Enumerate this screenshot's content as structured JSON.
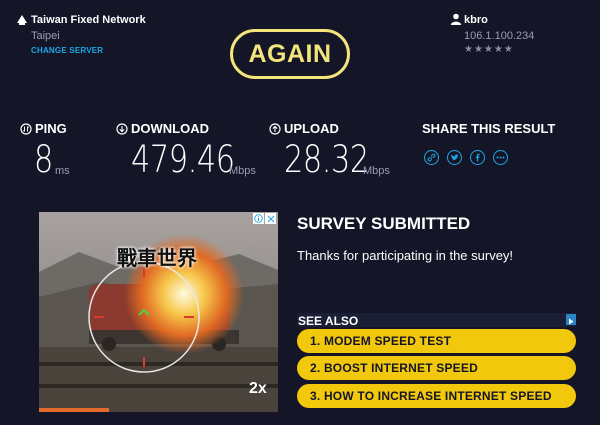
{
  "server": {
    "name": "Taiwan Fixed Network",
    "city": "Taipei",
    "change_label": "CHANGE SERVER"
  },
  "again_label": "AGAIN",
  "user": {
    "name": "kbro",
    "ip": "106.1.100.234",
    "stars": "★★★★★"
  },
  "metrics": {
    "ping": {
      "label": "PING",
      "value": "8",
      "unit": "ms"
    },
    "download": {
      "label": "DOWNLOAD",
      "value": "479.46",
      "unit": "Mbps"
    },
    "upload": {
      "label": "UPLOAD",
      "value": "28.32",
      "unit": "Mbps"
    }
  },
  "share": {
    "label": "SHARE THIS RESULT",
    "icons": [
      "link-icon",
      "twitter-icon",
      "facebook-icon",
      "more-icon"
    ]
  },
  "ad": {
    "title": "戰車世界",
    "badge": "2x"
  },
  "survey": {
    "title": "SURVEY SUBMITTED",
    "text": "Thanks for participating in the survey!"
  },
  "see_also": {
    "label": "SEE ALSO",
    "links": [
      "1.  MODEM SPEED TEST",
      "2.  BOOST INTERNET SPEED",
      "3.  HOW TO INCREASE INTERNET SPEED"
    ]
  },
  "colors": {
    "background": "#141526",
    "accent_yellow": "#f3e47b",
    "accent_blue": "#1ea7e6",
    "link_yellow": "#f2c80d"
  }
}
